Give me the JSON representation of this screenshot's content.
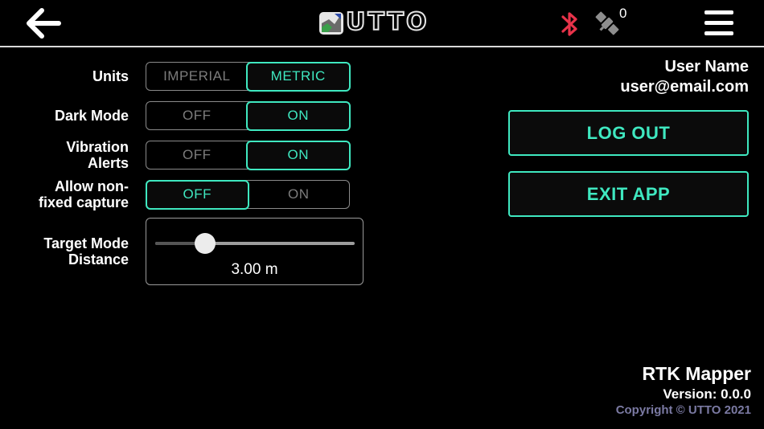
{
  "header": {
    "logo_text": "UTTO",
    "satellite_count": "0"
  },
  "settings": {
    "units": {
      "label": "Units",
      "options": [
        "IMPERIAL",
        "METRIC"
      ],
      "selected": "METRIC"
    },
    "dark_mode": {
      "label": "Dark Mode",
      "options": [
        "OFF",
        "ON"
      ],
      "selected": "ON"
    },
    "vibration_alerts": {
      "label_line1": "Vibration",
      "label_line2": "Alerts",
      "options": [
        "OFF",
        "ON"
      ],
      "selected": "ON"
    },
    "allow_non_fixed_capture": {
      "label_line1": "Allow non-",
      "label_line2": "fixed capture",
      "options": [
        "OFF",
        "ON"
      ],
      "selected": "OFF"
    },
    "target_mode_distance": {
      "label_line1": "Target Mode",
      "label_line2": "Distance",
      "value_text": "3.00 m",
      "slider_fraction": 0.25
    }
  },
  "account": {
    "user_name": "User Name",
    "user_email": "user@email.com",
    "logout_label": "LOG OUT",
    "exit_label": "EXIT APP"
  },
  "footer": {
    "app_name": "RTK Mapper",
    "version": "Version: 0.0.0",
    "copyright": "Copyright © UTTO 2021"
  },
  "colors": {
    "accent": "#3fe8c0",
    "bluetooth": "#e8334a",
    "background": "#000000",
    "muted_text": "#7c7c7c",
    "copyright": "#7b7aa3"
  }
}
